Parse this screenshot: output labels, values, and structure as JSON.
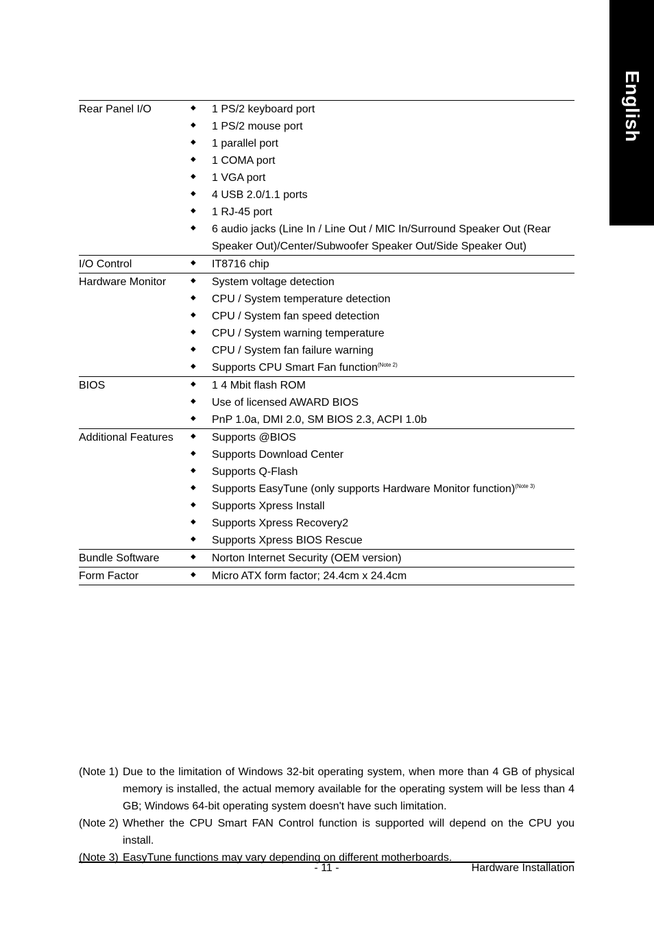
{
  "side_tab": {
    "label": "English"
  },
  "specs": [
    {
      "label": "Rear Panel I/O",
      "items": [
        {
          "text": "1 PS/2 keyboard port"
        },
        {
          "text": "1 PS/2 mouse port"
        },
        {
          "text": "1 parallel port"
        },
        {
          "text": "1 COMA port"
        },
        {
          "text": "1 VGA port"
        },
        {
          "text": "4 USB 2.0/1.1 ports"
        },
        {
          "text": "1 RJ-45 port"
        },
        {
          "text": "6 audio jacks (Line In / Line Out / MIC In/Surround Speaker Out (Rear Speaker Out)/Center/Subwoofer Speaker Out/Side Speaker Out)"
        }
      ]
    },
    {
      "label": "I/O Control",
      "items": [
        {
          "text": "IT8716 chip"
        }
      ]
    },
    {
      "label": "Hardware Monitor",
      "items": [
        {
          "text": "System voltage detection"
        },
        {
          "text": "CPU / System temperature detection"
        },
        {
          "text": "CPU / System fan speed detection"
        },
        {
          "text": "CPU / System warning temperature"
        },
        {
          "text": "CPU / System fan failure warning"
        },
        {
          "text": "Supports CPU Smart Fan function",
          "note": "(Note 2)"
        }
      ]
    },
    {
      "label": "BIOS",
      "items": [
        {
          "text": "1 4 Mbit flash ROM"
        },
        {
          "text": "Use of licensed AWARD BIOS"
        },
        {
          "text": "PnP 1.0a, DMI 2.0, SM BIOS 2.3, ACPI 1.0b"
        }
      ]
    },
    {
      "label": "Additional Features",
      "items": [
        {
          "text": "Supports @BIOS"
        },
        {
          "text": "Supports Download Center"
        },
        {
          "text": "Supports Q-Flash"
        },
        {
          "text": "Supports EasyTune (only supports Hardware Monitor function)",
          "note": "(Note 3)"
        },
        {
          "text": "Supports Xpress Install"
        },
        {
          "text": "Supports Xpress Recovery2"
        },
        {
          "text": "Supports Xpress BIOS Rescue"
        }
      ]
    },
    {
      "label": "Bundle Software",
      "items": [
        {
          "text": "Norton Internet Security (OEM version)"
        }
      ]
    },
    {
      "label": "Form Factor",
      "items": [
        {
          "text": "Micro ATX form factor; 24.4cm x 24.4cm"
        }
      ]
    }
  ],
  "notes": [
    {
      "label": "(Note 1)",
      "text": "Due to the limitation of Windows 32-bit operating system, when more than 4 GB of physical memory is installed, the actual memory available for the operating system will be less than 4 GB; Windows 64-bit operating system doesn't have such limitation."
    },
    {
      "label": "(Note 2)",
      "text": "Whether the CPU Smart FAN Control function is supported will depend on the CPU you install."
    },
    {
      "label": "(Note 3)",
      "text": "EasyTune functions may vary depending on different motherboards."
    }
  ],
  "footer": {
    "page_number": "- 11 -",
    "section": "Hardware Installation"
  }
}
